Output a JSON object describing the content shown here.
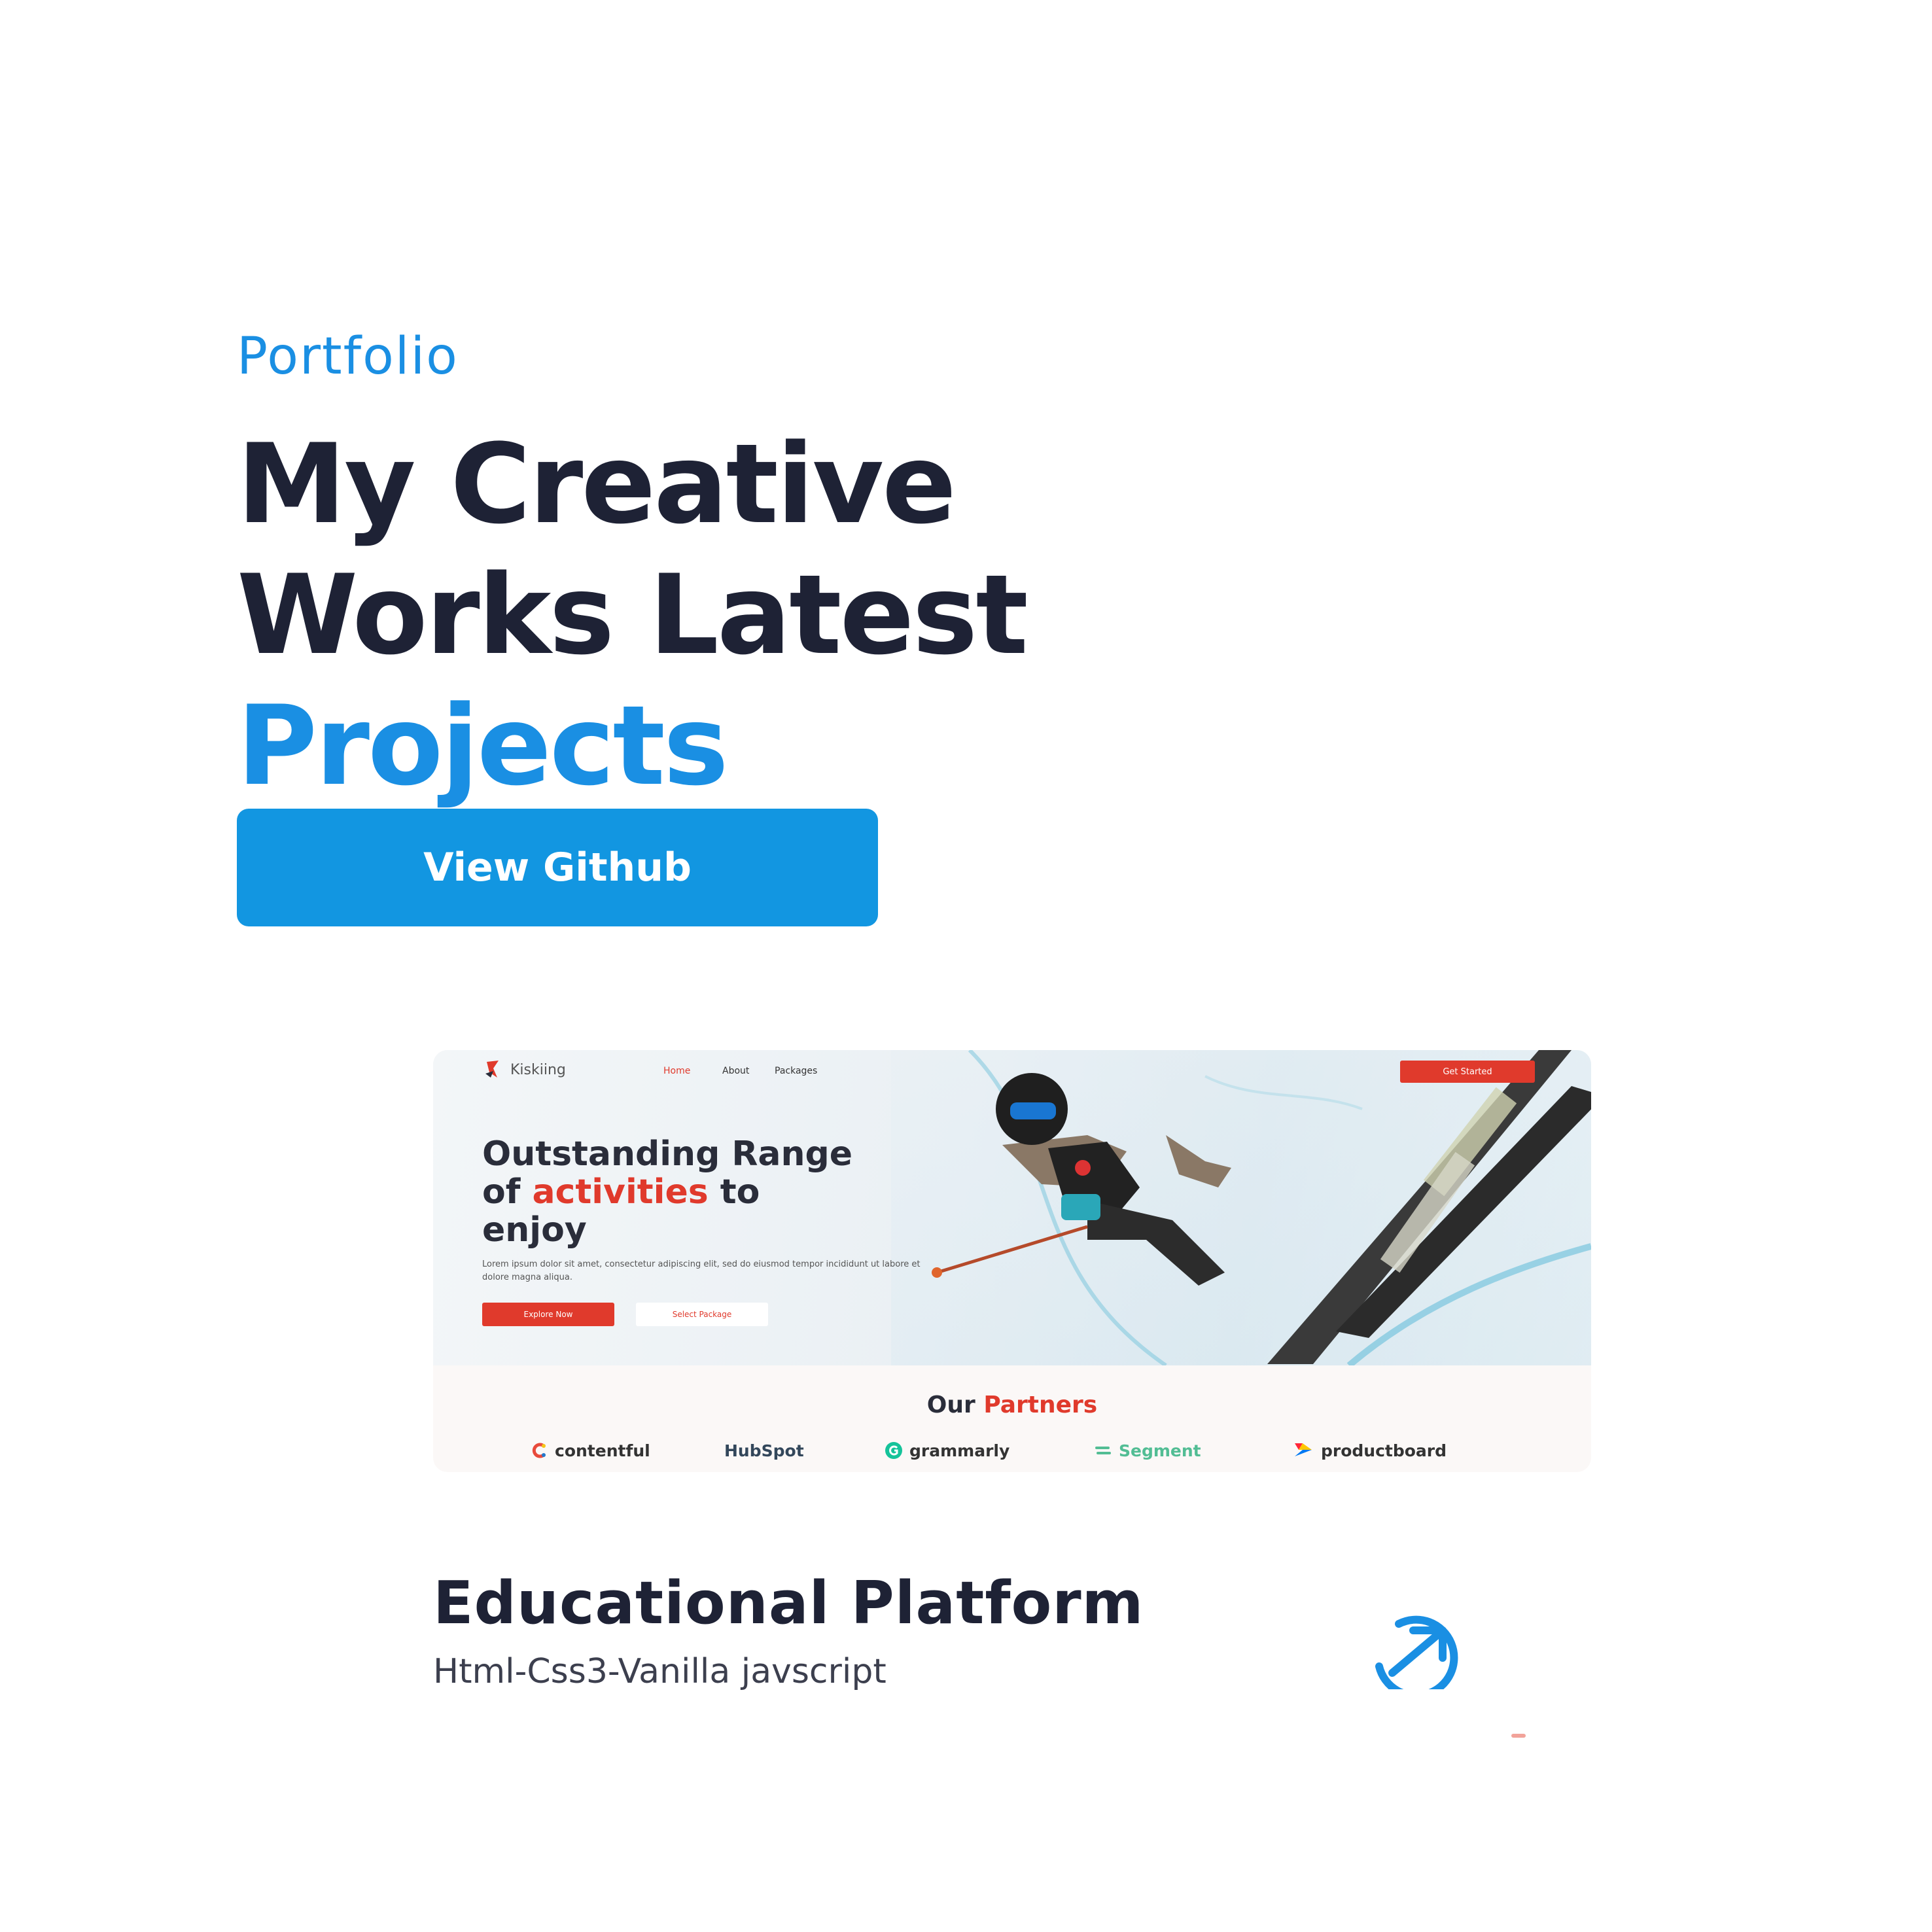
{
  "hero": {
    "eyebrow": "Portfolio",
    "headline_line1": "My Creative",
    "headline_line2": "Works Latest",
    "headline_accent": "Projects",
    "button_label": "View Github"
  },
  "preview": {
    "brand": "Kiskiing",
    "nav": [
      "Home",
      "About",
      "Packages"
    ],
    "cta": "Get Started",
    "title_part1": "Outstanding Range",
    "title_part2a": "of ",
    "title_highlight": "activities",
    "title_part2b": " to",
    "title_part3": "enjoy",
    "description": "Lorem ipsum dolor sit amet, consectetur adipiscing elit, sed do eiusmod tempor incididunt ut labore et dolore magna aliqua.",
    "primary_button": "Explore Now",
    "secondary_button": "Select Package",
    "partners_prefix": "Our ",
    "partners_highlight": "Partners",
    "partners": [
      "contentful",
      "HubSpot",
      "grammarly",
      "Segment",
      "productboard"
    ]
  },
  "project": {
    "title": "Educational Platform",
    "tech": "Html-Css3-Vanilla javscript"
  },
  "icons": {
    "open_project": "arrow-up-right-circle-icon"
  },
  "colors": {
    "accent_blue": "#1a8fe3",
    "button_blue": "#1296e1",
    "heading_dark": "#1e2235",
    "preview_red": "#e03a2c"
  }
}
